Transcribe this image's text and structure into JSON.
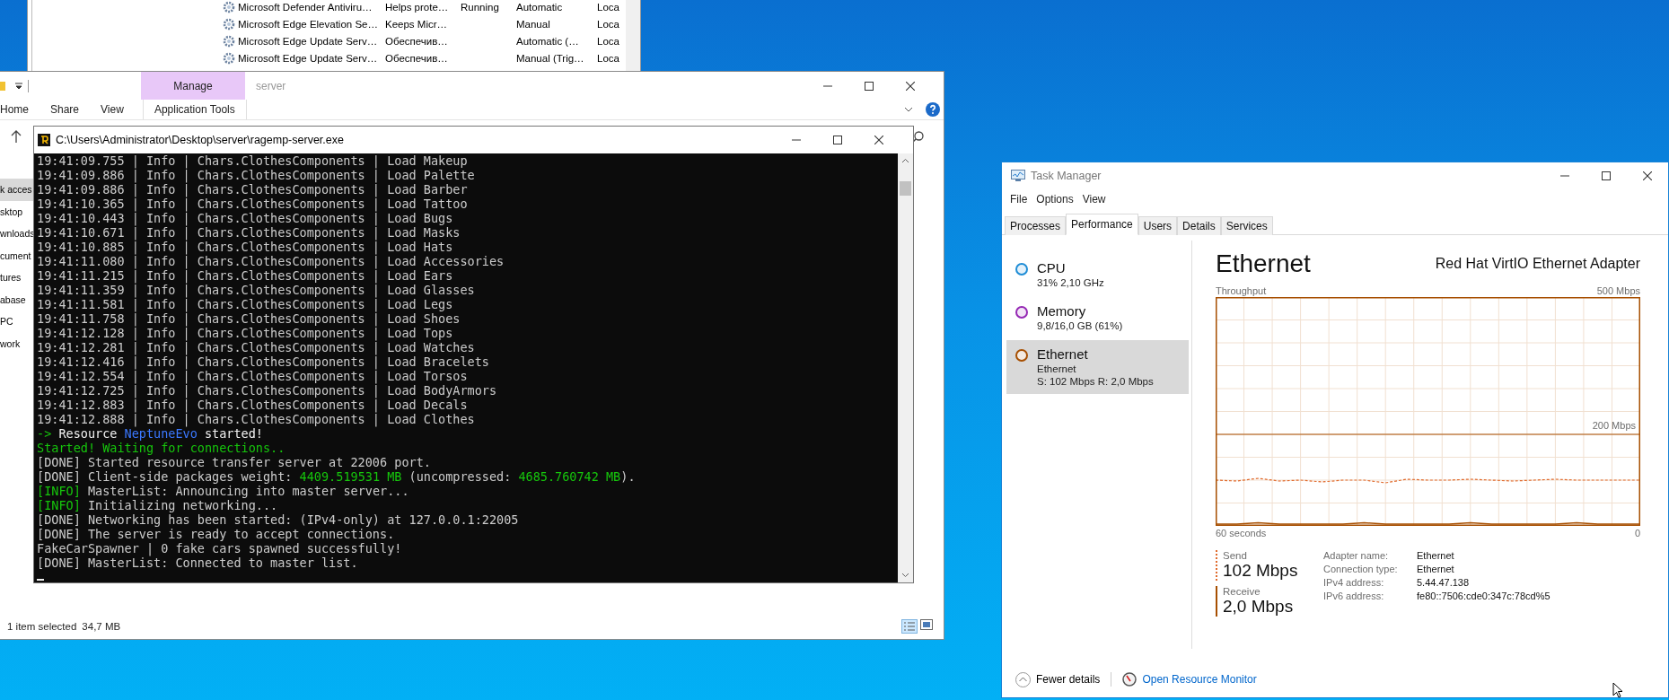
{
  "services_window": {
    "rows": [
      {
        "column_1": "Microsoft Defender Antiviru…",
        "column_2": "Helps prote…",
        "column_3": "Running",
        "column_4": "Automatic",
        "column_5": "Loca"
      },
      {
        "column_1": "Microsoft Edge Elevation Se…",
        "column_2": "Keeps Micr…",
        "column_4": "Manual",
        "column_5": "Loca"
      },
      {
        "column_1": "Microsoft Edge Update Serv…",
        "column_2": "Обеспечив…",
        "column_4": "Automatic (…",
        "column_5": "Loca"
      },
      {
        "column_1": "Microsoft Edge Update Serv…",
        "column_2": "Обеспечив…",
        "column_4": "Manual (Trig…",
        "column_5": "Loca"
      }
    ]
  },
  "explorer": {
    "context_tab": "Manage",
    "title": "server",
    "ribbon_tabs": [
      {
        "label": "Home",
        "kind": "normal"
      },
      {
        "label": "Share",
        "kind": "normal"
      },
      {
        "label": "View",
        "kind": "normal"
      },
      {
        "label": "Application Tools",
        "kind": "contextual"
      }
    ],
    "nav_items": [
      {
        "label": "k acces",
        "selected": true
      },
      {
        "label": "sktop",
        "selected": false
      },
      {
        "label": "wnloads",
        "selected": false
      },
      {
        "label": "cument",
        "selected": false
      },
      {
        "label": "tures",
        "selected": false
      },
      {
        "label": "abase",
        "selected": false
      },
      {
        "label": "PC",
        "selected": false
      },
      {
        "label": "work",
        "selected": false
      }
    ],
    "status_bar": {
      "selection": "1 item selected",
      "size": "34,7 MB"
    }
  },
  "console": {
    "title": "C:\\Users\\Administrator\\Desktop\\server\\ragemp-server.exe",
    "lines": [
      {
        "text": "19:41:09.755 | Info | Chars.ClothesComponents | Load Makeup"
      },
      {
        "text": "19:41:09.886 | Info | Chars.ClothesComponents | Load Palette"
      },
      {
        "text": "19:41:09.886 | Info | Chars.ClothesComponents | Load Barber"
      },
      {
        "text": "19:41:10.365 | Info | Chars.ClothesComponents | Load Tattoo"
      },
      {
        "text": "19:41:10.443 | Info | Chars.ClothesComponents | Load Bugs"
      },
      {
        "text": "19:41:10.671 | Info | Chars.ClothesComponents | Load Masks"
      },
      {
        "text": "19:41:10.885 | Info | Chars.ClothesComponents | Load Hats"
      },
      {
        "text": "19:41:11.080 | Info | Chars.ClothesComponents | Load Accessories"
      },
      {
        "text": "19:41:11.215 | Info | Chars.ClothesComponents | Load Ears"
      },
      {
        "text": "19:41:11.359 | Info | Chars.ClothesComponents | Load Glasses"
      },
      {
        "text": "19:41:11.581 | Info | Chars.ClothesComponents | Load Legs"
      },
      {
        "text": "19:41:11.758 | Info | Chars.ClothesComponents | Load Shoes"
      },
      {
        "text": "19:41:12.128 | Info | Chars.ClothesComponents | Load Tops"
      },
      {
        "text": "19:41:12.281 | Info | Chars.ClothesComponents | Load Watches"
      },
      {
        "text": "19:41:12.416 | Info | Chars.ClothesComponents | Load Bracelets"
      },
      {
        "text": "19:41:12.554 | Info | Chars.ClothesComponents | Load Torsos"
      },
      {
        "text": "19:41:12.725 | Info | Chars.ClothesComponents | Load BodyArmors"
      },
      {
        "text": "19:41:12.883 | Info | Chars.ClothesComponents | Load Decals"
      },
      {
        "text": "19:41:12.888 | Info | Chars.ClothesComponents | Load Clothes"
      },
      {
        "segments": [
          {
            "text": "->",
            "color": "#16c60c"
          },
          {
            "text": " Resource ",
            "color": "#f2f2f2"
          },
          {
            "text": "NeptuneEvo",
            "color": "#3b78ff"
          },
          {
            "text": " started!",
            "color": "#f2f2f2"
          }
        ]
      },
      {
        "segments": [
          {
            "text": "Started! Waiting for connections..",
            "color": "#16c60c"
          }
        ]
      },
      {
        "text": "[DONE] Started resource transfer server at 22006 port."
      },
      {
        "segments": [
          {
            "text": "[DONE] Client-side packages weight: ",
            "color": "#cccccc"
          },
          {
            "text": "4409.519531 MB",
            "color": "#16c60c"
          },
          {
            "text": " (uncompressed: ",
            "color": "#cccccc"
          },
          {
            "text": "4685.760742 MB",
            "color": "#16c60c"
          },
          {
            "text": ").",
            "color": "#cccccc"
          }
        ]
      },
      {
        "segments": [
          {
            "text": "[INFO]",
            "color": "#16c60c"
          },
          {
            "text": " MasterList: Announcing into master server...",
            "color": "#cccccc"
          }
        ]
      },
      {
        "segments": [
          {
            "text": "[INFO]",
            "color": "#16c60c"
          },
          {
            "text": " Initializing networking...",
            "color": "#cccccc"
          }
        ]
      },
      {
        "text": "[DONE] Networking has been started: (IPv4-only) at 127.0.0.1:22005"
      },
      {
        "text": "[DONE] The server is ready to accept connections."
      },
      {
        "text": "FakeCarSpawner | 0 fake cars spawned successfully!"
      },
      {
        "text": "[DONE] MasterList: Connected to master list."
      }
    ]
  },
  "task_manager": {
    "title": "Task Manager",
    "menu": [
      "File",
      "Options",
      "View"
    ],
    "tabs": [
      {
        "label": "Processes",
        "selected": false
      },
      {
        "label": "Performance",
        "selected": true
      },
      {
        "label": "Users",
        "selected": false
      },
      {
        "label": "Details",
        "selected": false
      },
      {
        "label": "Services",
        "selected": false
      }
    ],
    "resources": [
      {
        "name": "CPU",
        "details": [
          "31% 2,10 GHz"
        ],
        "color": "#1f8dd6",
        "selected": false
      },
      {
        "name": "Memory",
        "details": [
          "9,8/16,0 GB (61%)"
        ],
        "color": "#9528b4",
        "selected": false
      },
      {
        "name": "Ethernet",
        "details": [
          "Ethernet",
          "S: 102 Mbps R: 2,0 Mbps"
        ],
        "color": "#a74f01",
        "selected": true
      }
    ],
    "panel": {
      "heading": "Ethernet",
      "adapter": "Red Hat VirtIO Ethernet Adapter",
      "graph": {
        "title": "Throughput",
        "top_label": "500 Mbps",
        "mid_label": "200 Mbps",
        "left_label": "60 seconds",
        "right_label": "0"
      },
      "legend": [
        {
          "label": "Send",
          "value": "102 Mbps",
          "kind": "send"
        },
        {
          "label": "Receive",
          "value": "2,0 Mbps",
          "kind": "receive"
        }
      ],
      "properties": [
        {
          "label": "Adapter name:",
          "value": "Ethernet"
        },
        {
          "label": "Connection type:",
          "value": "Ethernet"
        },
        {
          "label": "IPv4 address:",
          "value": "5.44.47.138"
        },
        {
          "label": "IPv6 address:",
          "value": "fe80::7506:cde0:347c:78cd%5"
        }
      ]
    },
    "footer": {
      "fewer_details": "Fewer details",
      "resource_monitor_link": "Open Resource Monitor"
    }
  }
}
